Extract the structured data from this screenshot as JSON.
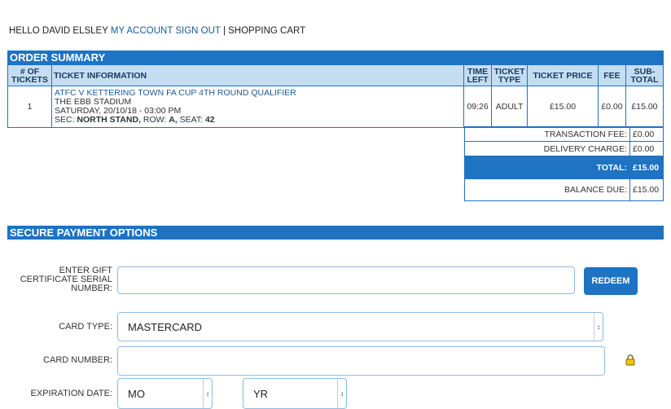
{
  "topnav": {
    "greeting": "HELLO DAVID ELSLEY",
    "my_account": "MY ACCOUNT",
    "sign_out": "SIGN OUT",
    "separator": "|",
    "shopping_cart": "SHOPPING CART"
  },
  "order_summary": {
    "title": "ORDER SUMMARY",
    "headers": {
      "num_tickets": "# OF TICKETS",
      "ticket_info": "TICKET INFORMATION",
      "time_left": "TIME LEFT",
      "ticket_type": "TICKET TYPE",
      "ticket_price": "TICKET PRICE",
      "fee": "FEE",
      "subtotal": "SUB-TOTAL"
    },
    "row": {
      "num_tickets": "1",
      "event": "ATFC V KETTERING TOWN FA CUP 4TH ROUND QUALIFIER",
      "venue": "THE EBB STADIUM",
      "date": "SATURDAY, 20/10/18 - 03:00 PM",
      "sec_label": "SEC:",
      "section": "NORTH STAND,",
      "row_label": "ROW:",
      "row": "A,",
      "seat_label": "SEAT:",
      "seat": "42",
      "time_left": "09:26",
      "ticket_type": "ADULT",
      "ticket_price": "£15.00",
      "fee": "£0.00",
      "subtotal": "£15.00"
    },
    "totals": {
      "transaction_fee_label": "TRANSACTION FEE:",
      "transaction_fee": "£0.00",
      "delivery_charge_label": "DELIVERY CHARGE:",
      "delivery_charge": "£0.00",
      "total_label": "TOTAL:",
      "total": "£15.00",
      "balance_due_label": "BALANCE DUE:",
      "balance_due": "£15.00"
    }
  },
  "payment": {
    "title": "SECURE PAYMENT OPTIONS",
    "gift_label": "ENTER GIFT CERTIFICATE SERIAL NUMBER:",
    "gift_value": "",
    "redeem_label": "REDEEM",
    "card_type_label": "CARD TYPE:",
    "card_type_value": "MASTERCARD",
    "card_number_label": "CARD NUMBER:",
    "card_number_value": "",
    "lock_icon": "lock-icon",
    "expiration_label": "EXPIRATION DATE:",
    "exp_month_value": "MO",
    "exp_year_value": "YR"
  },
  "colors": {
    "accent": "#1e73c3",
    "header_cell_bg": "#c5ddf1",
    "link": "#1a5a96"
  }
}
